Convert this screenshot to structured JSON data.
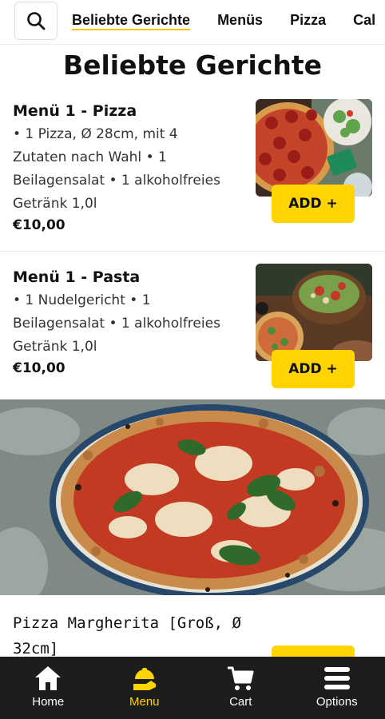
{
  "categories": [
    "Beliebte Gerichte",
    "Menüs",
    "Pizza",
    "Cal"
  ],
  "section_title": "Beliebte Gerichte",
  "items": [
    {
      "title": "Menü 1 - Pizza",
      "desc": [
        "• 1 Pizza, Ø 28cm, mit 4",
        "Zutaten nach Wahl • 1",
        "Beilagensalat • 1 alkoholfreies",
        "Getränk 1,0l"
      ],
      "price": "€10,00",
      "add_label": "ADD +"
    },
    {
      "title": "Menü 1 - Pasta",
      "desc": [
        "• 1 Nudelgericht • 1",
        "Beilagensalat • 1 alkoholfreies",
        "Getränk 1,0l"
      ],
      "price": "€10,00",
      "add_label": "ADD +"
    },
    {
      "title": "Pizza Margherita [Groß, Ø 32cm]"
    }
  ],
  "nav": [
    {
      "label": "Home",
      "icon": "home-icon"
    },
    {
      "label": "Menu",
      "icon": "menu-dish-icon"
    },
    {
      "label": "Cart",
      "icon": "cart-icon"
    },
    {
      "label": "Options",
      "icon": "hamburger-icon"
    }
  ],
  "colors": {
    "accent": "#ffd400",
    "nav_bg": "#1d1d1d"
  }
}
